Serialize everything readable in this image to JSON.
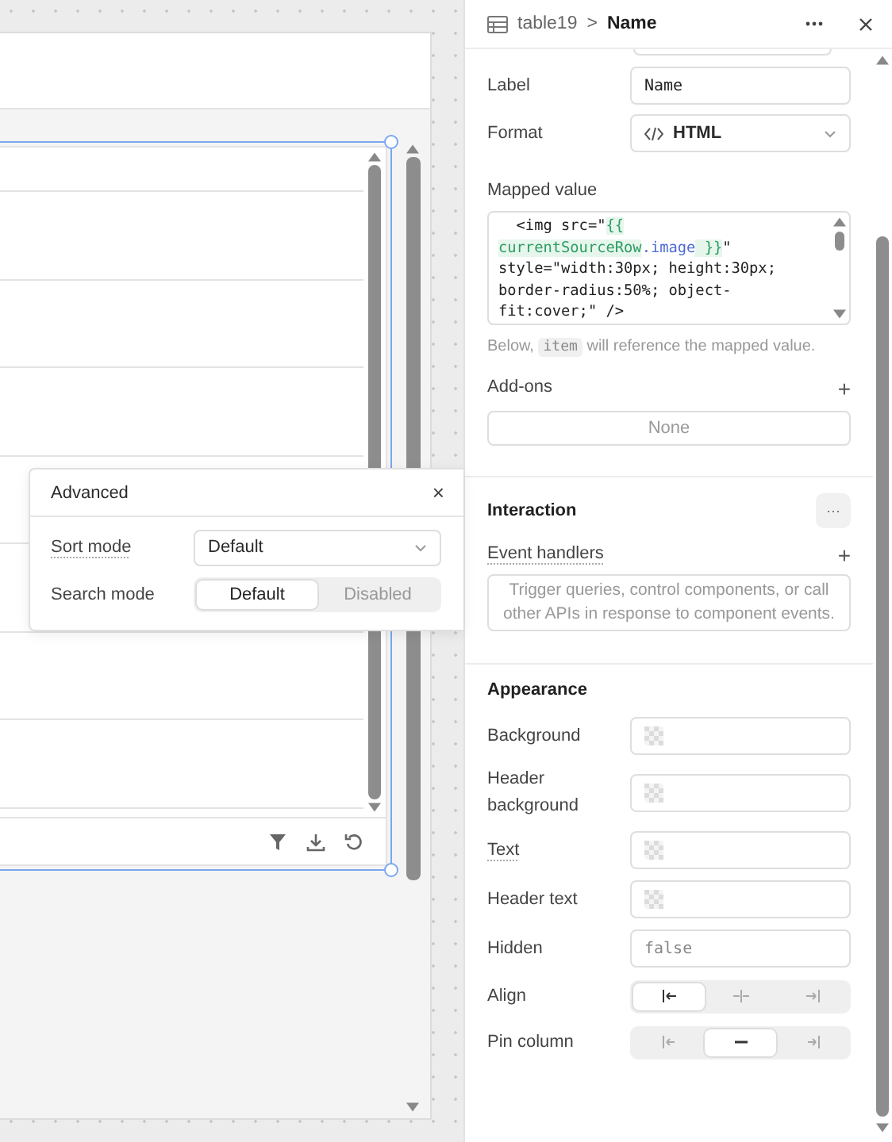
{
  "advanced_popover": {
    "title": "Advanced",
    "close": "×",
    "sort_mode": {
      "label": "Sort mode",
      "tooltip": true,
      "value": "Default"
    },
    "search_mode": {
      "label": "Search mode",
      "tooltip": false,
      "options": [
        {
          "label": "Default",
          "selected": true
        },
        {
          "label": "Disabled",
          "selected": false
        }
      ]
    }
  },
  "inspector": {
    "breadcrumb": {
      "parent": "table19",
      "separator": ">",
      "current": "Name"
    },
    "label_field": {
      "label": "Label",
      "value": "Name"
    },
    "format_field": {
      "label": "Format",
      "value": "HTML"
    },
    "mapped_value": {
      "label": "Mapped value",
      "lines": [
        [
          {
            "text": "  <img src=\"",
            "kind": "plain"
          },
          {
            "text": "{{",
            "kind": "template"
          }
        ],
        [
          {
            "text": "currentSourceRow",
            "kind": "template"
          },
          {
            "text": ".image",
            "kind": "property"
          },
          {
            "text": " }}",
            "kind": "template"
          },
          {
            "text": "\"",
            "kind": "plain"
          }
        ],
        [
          {
            "text": "style=\"width:30px; height:30px;",
            "kind": "plain"
          }
        ],
        [
          {
            "text": "border-radius:50%; object-",
            "kind": "plain"
          }
        ],
        [
          {
            "text": "fit:cover;\" />",
            "kind": "plain"
          }
        ]
      ],
      "hint": [
        {
          "text": "Below, ",
          "kind": "plain"
        },
        {
          "text": "item",
          "kind": "code"
        },
        {
          "text": " will reference the mapped value.",
          "kind": "plain"
        }
      ]
    },
    "addons": {
      "label": "Add-ons",
      "plus": "+",
      "empty": "None"
    },
    "interaction": {
      "title": "Interaction",
      "more": "···",
      "event_handlers": {
        "label": "Event handlers",
        "tooltip": true,
        "plus": "+",
        "empty": "Trigger queries, control components, or call other APIs in response to component events."
      }
    },
    "appearance": {
      "title": "Appearance",
      "rows": [
        {
          "kind": "color",
          "label": "Background",
          "tooltip": false
        },
        {
          "kind": "color",
          "label": "Header background",
          "tooltip": false
        },
        {
          "kind": "color",
          "label": "Text",
          "tooltip": true
        },
        {
          "kind": "color",
          "label": "Header text",
          "tooltip": false
        },
        {
          "kind": "text",
          "label": "Hidden",
          "tooltip": false,
          "placeholder": "false"
        },
        {
          "kind": "align",
          "label": "Align",
          "tooltip": false,
          "options": [
            {
              "selected": true
            },
            {
              "selected": false
            },
            {
              "selected": false
            }
          ]
        },
        {
          "kind": "pin",
          "label": "Pin column",
          "tooltip": false,
          "options": [
            {
              "selected": false
            },
            {
              "selected": true
            },
            {
              "selected": false
            }
          ]
        }
      ]
    }
  }
}
